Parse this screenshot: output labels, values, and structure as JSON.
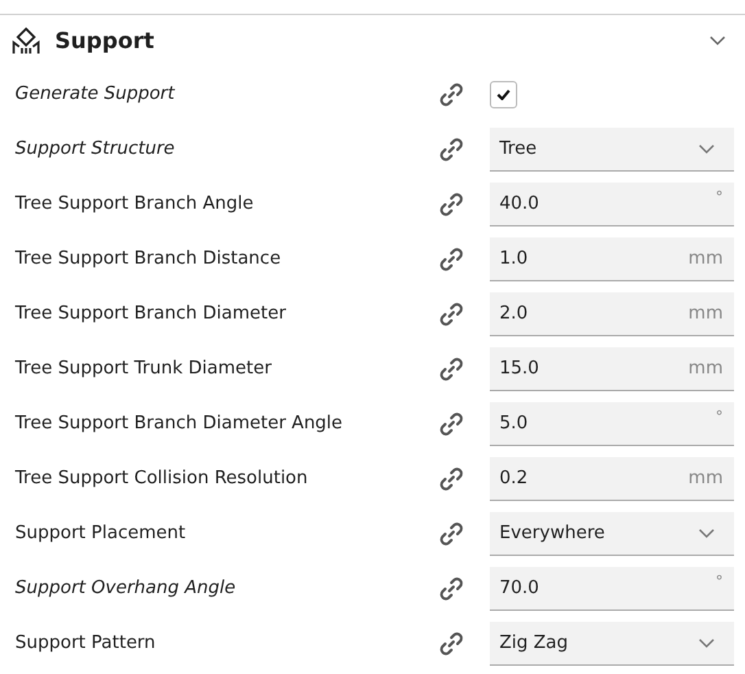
{
  "section": {
    "title": "Support",
    "expanded": true
  },
  "settings": [
    {
      "label": "Generate Support",
      "modified": true,
      "kind": "checkbox",
      "checked": true
    },
    {
      "label": "Support Structure",
      "modified": true,
      "kind": "dropdown",
      "value": "Tree"
    },
    {
      "label": "Tree Support Branch Angle",
      "modified": false,
      "kind": "number",
      "value": "40.0",
      "unit": "°"
    },
    {
      "label": "Tree Support Branch Distance",
      "modified": false,
      "kind": "number",
      "value": "1.0",
      "unit": "mm"
    },
    {
      "label": "Tree Support Branch Diameter",
      "modified": false,
      "kind": "number",
      "value": "2.0",
      "unit": "mm"
    },
    {
      "label": "Tree Support Trunk Diameter",
      "modified": false,
      "kind": "number",
      "value": "15.0",
      "unit": "mm"
    },
    {
      "label": "Tree Support Branch Diameter Angle",
      "modified": false,
      "kind": "number",
      "value": "5.0",
      "unit": "°"
    },
    {
      "label": "Tree Support Collision Resolution",
      "modified": false,
      "kind": "number",
      "value": "0.2",
      "unit": "mm"
    },
    {
      "label": "Support Placement",
      "modified": false,
      "kind": "dropdown",
      "value": "Everywhere"
    },
    {
      "label": "Support Overhang Angle",
      "modified": true,
      "kind": "number",
      "value": "70.0",
      "unit": "°"
    },
    {
      "label": "Support Pattern",
      "modified": false,
      "kind": "dropdown",
      "value": "Zig Zag"
    }
  ]
}
